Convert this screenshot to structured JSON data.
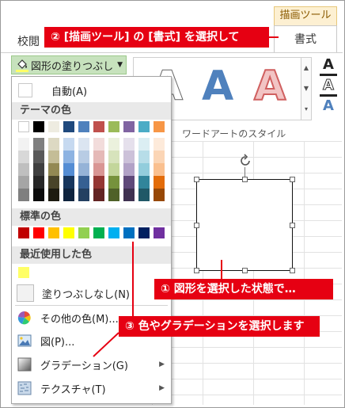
{
  "ribbon": {
    "context_tab": "描画ツール",
    "tab_review": "校閲",
    "tab_format": "書式",
    "shape_fill_button": "図形の塗りつぶし",
    "wordart_group_label": "ワードアートのスタイル",
    "wordart_sample": "A"
  },
  "fill_menu": {
    "auto_label": "自動(A)",
    "theme_header": "テーマの色",
    "theme_top": [
      "#ffffff",
      "#000000",
      "#eeece1",
      "#1f497d",
      "#4f81bd",
      "#c0504d",
      "#9bbb59",
      "#8064a2",
      "#4bacc6",
      "#f79646"
    ],
    "theme_shades": [
      [
        "#f2f2f2",
        "#7f7f7f",
        "#ddd9c3",
        "#c6d9f0",
        "#dbe5f1",
        "#f2dcdb",
        "#ebf1dd",
        "#e5e0ec",
        "#dbeef3",
        "#fdeada"
      ],
      [
        "#d8d8d8",
        "#595959",
        "#c4bd97",
        "#8db3e2",
        "#b8cce4",
        "#e5b9b7",
        "#d7e3bc",
        "#ccc1d9",
        "#b7dde8",
        "#fbd5b5"
      ],
      [
        "#bfbfbf",
        "#3f3f3f",
        "#938953",
        "#548dd4",
        "#95b3d7",
        "#d99694",
        "#c3d69b",
        "#b2a2c7",
        "#92cddc",
        "#fac08f"
      ],
      [
        "#a5a5a5",
        "#262626",
        "#494429",
        "#17365d",
        "#366092",
        "#953734",
        "#76923c",
        "#5f497a",
        "#31859b",
        "#e36c09"
      ],
      [
        "#7f7f7f",
        "#0c0c0c",
        "#1d1b10",
        "#0f243e",
        "#244061",
        "#632423",
        "#4f6128",
        "#3f3151",
        "#205867",
        "#974806"
      ]
    ],
    "standard_header": "標準の色",
    "standard_colors": [
      "#c00000",
      "#ff0000",
      "#ffc000",
      "#ffff00",
      "#92d050",
      "#00b050",
      "#00b0f0",
      "#0070c0",
      "#002060",
      "#7030a0"
    ],
    "recent_header": "最近使用した色",
    "recent_colors": [
      "#ffff66"
    ],
    "no_fill": "塗りつぶしなし(N)",
    "more_colors": "その他の色(M)...",
    "picture": "図(P)...",
    "gradient": "グラデーション(G)",
    "texture": "テクスチャ(T)"
  },
  "callouts": {
    "step1": "① 図形を選択した状態で…",
    "step2": "② [描画ツール] の [書式] を選択して",
    "step3": "③ 色やグラデーションを選択します"
  }
}
